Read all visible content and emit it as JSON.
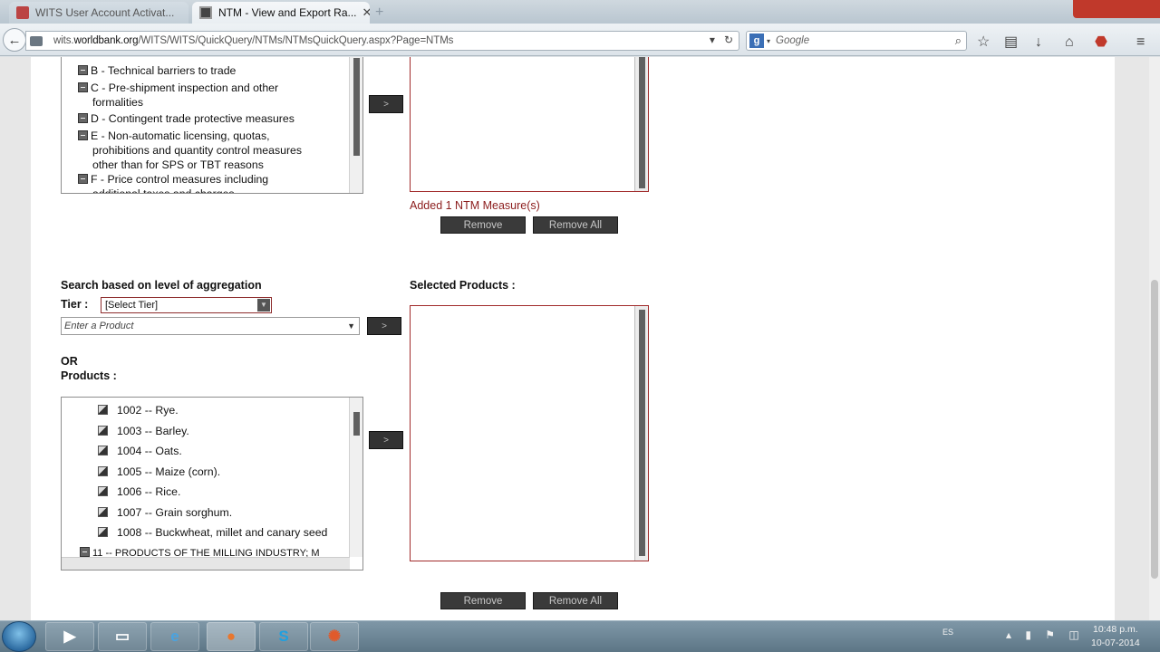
{
  "browser": {
    "tabs": [
      {
        "title": "WITS User Account Activat...",
        "active": false
      },
      {
        "title": "NTM - View and Export Ra...",
        "active": true
      }
    ],
    "url_prefix": "wits.",
    "url_domain": "worldbank.org",
    "url_path": "/WITS/WITS/QuickQuery/NTMs/NTMsQuickQuery.aspx?Page=NTMs",
    "search_placeholder": "Google"
  },
  "ntm": {
    "tree_items": [
      {
        "code": "B",
        "lines": [
          "B - Technical barriers to trade"
        ]
      },
      {
        "code": "C",
        "lines": [
          "C - Pre-shipment inspection and other",
          "formalities"
        ]
      },
      {
        "code": "D",
        "lines": [
          "D - Contingent trade protective measures"
        ]
      },
      {
        "code": "E",
        "lines": [
          "E - Non-automatic licensing, quotas,",
          "prohibitions and quantity control measures",
          "other than for SPS or TBT reasons"
        ]
      },
      {
        "code": "F",
        "lines": [
          "F - Price control measures including",
          "additional taxes and charges"
        ]
      }
    ],
    "add_button": ">",
    "added_message": "Added 1 NTM Measure(s)",
    "remove_label": "Remove",
    "remove_all_label": "Remove All"
  },
  "products": {
    "aggregation_heading": "Search based on level of aggregation",
    "tier_label": "Tier :",
    "tier_value": "[Select Tier]",
    "product_placeholder": "Enter a Product",
    "add_button": ">",
    "or_label": "OR",
    "products_label": "Products :",
    "selected_heading": "Selected Products :",
    "items": [
      "1002 -- Rye.",
      "1003 -- Barley.",
      "1004 -- Oats.",
      "1005 -- Maize (corn).",
      "1006 -- Rice.",
      "1007 -- Grain sorghum.",
      "1008 -- Buckwheat, millet and canary seed"
    ],
    "chapter_item": "11 -- PRODUCTS OF THE MILLING INDUSTRY; M",
    "remove_label": "Remove",
    "remove_all_label": "Remove All"
  },
  "taskbar": {
    "language": "ES",
    "time": "10:48 p.m.",
    "date": "10-07-2014",
    "apps": [
      "media",
      "explorer",
      "ie",
      "firefox",
      "skype",
      "reel"
    ]
  },
  "colors": {
    "accent_red": "#a12b2b",
    "dark_button": "#3a3a3a",
    "message_red": "#8b1c1c"
  }
}
